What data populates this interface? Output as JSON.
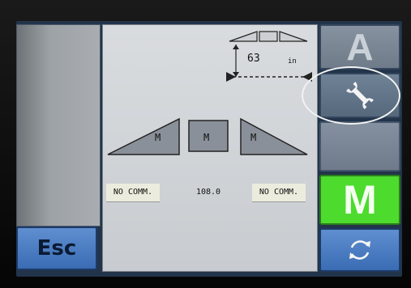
{
  "esc_button": {
    "label": "Esc"
  },
  "boom_height": {
    "value": "63",
    "unit": "in"
  },
  "sections": {
    "left": {
      "mode": "M",
      "status": "NO COMM."
    },
    "center": {
      "mode": "M",
      "status": "108.0"
    },
    "right": {
      "mode": "M",
      "status": "NO COMM."
    }
  },
  "right_buttons": {
    "auto_label": "A",
    "manual_label": "M"
  },
  "icons": {
    "settings": "wrench-icon",
    "refresh": "refresh-icon"
  },
  "colors": {
    "manual_active": "#4ddb2e",
    "button_blue": "#3a6cb4"
  }
}
